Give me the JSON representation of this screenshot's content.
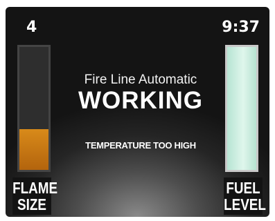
{
  "flame": {
    "value": "4",
    "label_line1": "FLAME",
    "label_line2": "SIZE",
    "fill_percent": 33,
    "color": "#c9790f"
  },
  "clock": "9:37",
  "status": {
    "subtitle": "Fire Line Automatic",
    "state": "WORKING",
    "warning": "TEMPERATURE TOO HIGH"
  },
  "fuel": {
    "label_line1": "FUEL",
    "label_line2": "LEVEL",
    "fill_percent": 100,
    "color": "#cdeee0"
  }
}
